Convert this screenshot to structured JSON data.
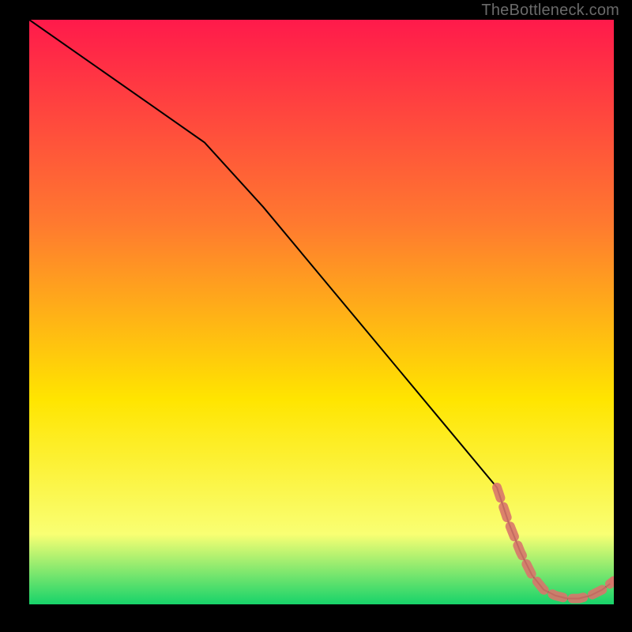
{
  "watermark": "TheBottleneck.com",
  "colors": {
    "frame": "#000000",
    "watermark": "#6a6a6a",
    "gradient_top": "#ff1a4b",
    "gradient_mid1": "#ff7a2f",
    "gradient_mid2": "#ffe500",
    "gradient_mid3": "#f9ff73",
    "gradient_bottom": "#17d36a",
    "curve": "#000000",
    "marker_fill": "#d8766b",
    "marker_stroke": "#d8766b"
  },
  "chart_data": {
    "type": "line",
    "title": "",
    "xlabel": "",
    "ylabel": "",
    "xlim": [
      0,
      100
    ],
    "ylim": [
      0,
      100
    ],
    "series": [
      {
        "name": "bottleneck-curve",
        "x": [
          0,
          10,
          20,
          30,
          40,
          50,
          60,
          70,
          80,
          82,
          84,
          86,
          88,
          90,
          92,
          94,
          96,
          98,
          100
        ],
        "y": [
          100,
          93,
          86,
          79,
          68,
          56,
          44,
          32,
          20,
          14,
          9,
          5,
          2.5,
          1.5,
          1.0,
          1.0,
          1.5,
          2.5,
          4
        ]
      }
    ],
    "highlight": {
      "name": "optimal-region",
      "x": [
        80,
        82,
        84,
        86,
        88,
        90,
        92,
        94,
        96,
        98,
        100
      ],
      "y": [
        20,
        14,
        9,
        5,
        2.5,
        1.5,
        1.0,
        1.0,
        1.5,
        2.5,
        4
      ]
    }
  }
}
